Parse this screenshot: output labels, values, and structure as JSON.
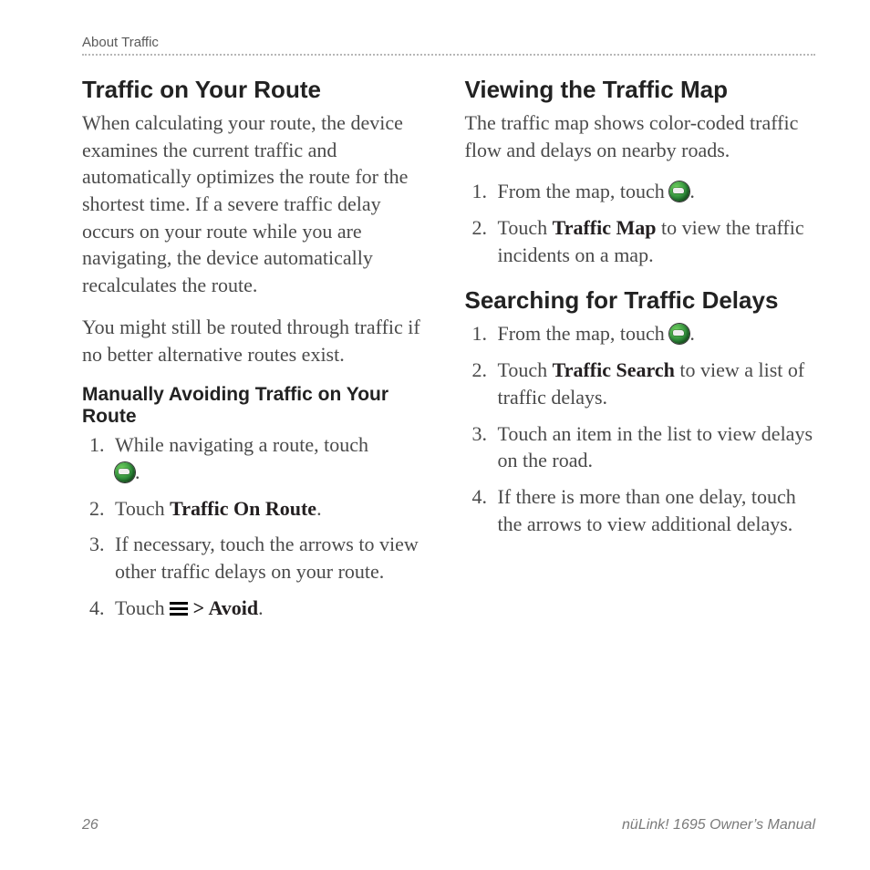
{
  "header": {
    "section": "About Traffic"
  },
  "left": {
    "h1": "Traffic on Your Route",
    "p1": "When calculating your route, the device examines the current traffic and automatically optimizes the route for the shortest time. If a severe traffic delay occurs on your route while you are navigating, the device automatically recalculates the route.",
    "p2": "You might still be routed through traffic if no better alternative routes exist.",
    "h2": "Manually Avoiding Traffic on Your Route",
    "steps": {
      "s1": "While navigating a route, touch ",
      "s2a": "Touch ",
      "s2b": "Traffic On Route",
      "s2c": ".",
      "s3": "If necessary, touch the arrows to view other traffic delays on your route.",
      "s4a": "Touch  ",
      "s4b": " > Avoid",
      "s4c": "."
    }
  },
  "right": {
    "h1": "Viewing the Traffic Map",
    "p1": "The traffic map shows color-coded traffic flow and delays on nearby roads.",
    "vsteps": {
      "s1": "From the map, touch ",
      "s2a": "Touch ",
      "s2b": "Traffic Map",
      "s2c": " to view the traffic incidents on a map."
    },
    "h2": "Searching for Traffic Delays",
    "ssteps": {
      "s1": "From the map, touch ",
      "s2a": "Touch ",
      "s2b": "Traffic Search",
      "s2c": " to view a list of traffic delays.",
      "s3": "Touch an item in the list to view delays on the road.",
      "s4": "If there is more than one delay, touch the arrows to view additional delays."
    }
  },
  "footer": {
    "page": "26",
    "title": "nüLink! 1695 Owner’s Manual"
  }
}
